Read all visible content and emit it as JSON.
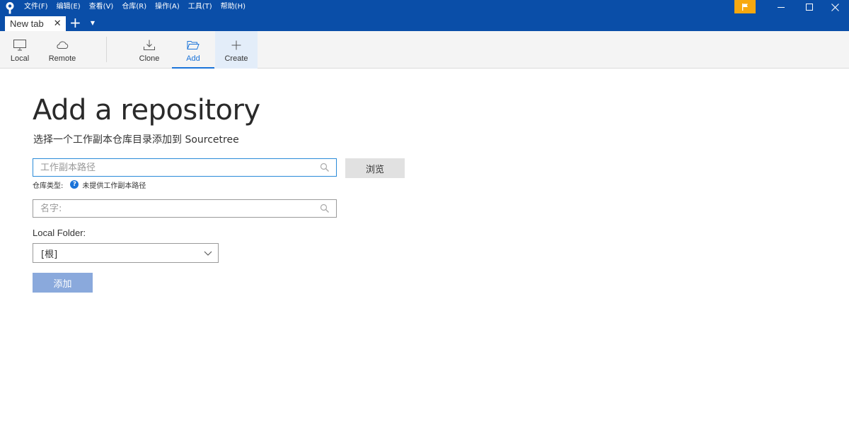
{
  "menu": [
    {
      "label": "文件(F)"
    },
    {
      "label": "编辑(E)"
    },
    {
      "label": "查看(V)"
    },
    {
      "label": "仓库(R)"
    },
    {
      "label": "操作(A)"
    },
    {
      "label": "工具(T)"
    },
    {
      "label": "帮助(H)"
    }
  ],
  "tabs": {
    "active_label": "New tab",
    "close_glyph": "✕",
    "add_glyph": "+",
    "dropdown_glyph": "▼"
  },
  "window_controls": {
    "minimize": "—",
    "maximize": "☐",
    "close": "✕"
  },
  "toolbar": {
    "local_label": "Local",
    "remote_label": "Remote",
    "clone_label": "Clone",
    "add_label": "Add",
    "create_label": "Create",
    "active": "Add"
  },
  "main": {
    "title": "Add a repository",
    "subtitle": "选择一个工作副本仓库目录添加到 Sourcetree",
    "path_input": {
      "value": "",
      "placeholder": "工作副本路径"
    },
    "browse_label": "浏览",
    "repo_type_label": "仓库类型:",
    "repo_type_help": "?",
    "repo_type_value": "未提供工作副本路径",
    "name_input": {
      "value": "",
      "placeholder": "名字:"
    },
    "local_folder_label": "Local Folder:",
    "local_folder_value": "[根]",
    "add_button_label": "添加"
  },
  "colors": {
    "titlebar": "#0a4ea8",
    "accent": "#1a73d9",
    "flag": "#f7a80f",
    "add_button_disabled": "#8aa9dc"
  },
  "icons": {
    "app": "sourcetree-logo-icon",
    "flag": "flag-icon",
    "local": "monitor-icon",
    "remote": "cloud-icon",
    "clone": "download-tray-icon",
    "add": "folder-open-icon",
    "create": "plus-icon",
    "search": "search-icon",
    "dropdown": "chevron-down-icon"
  }
}
